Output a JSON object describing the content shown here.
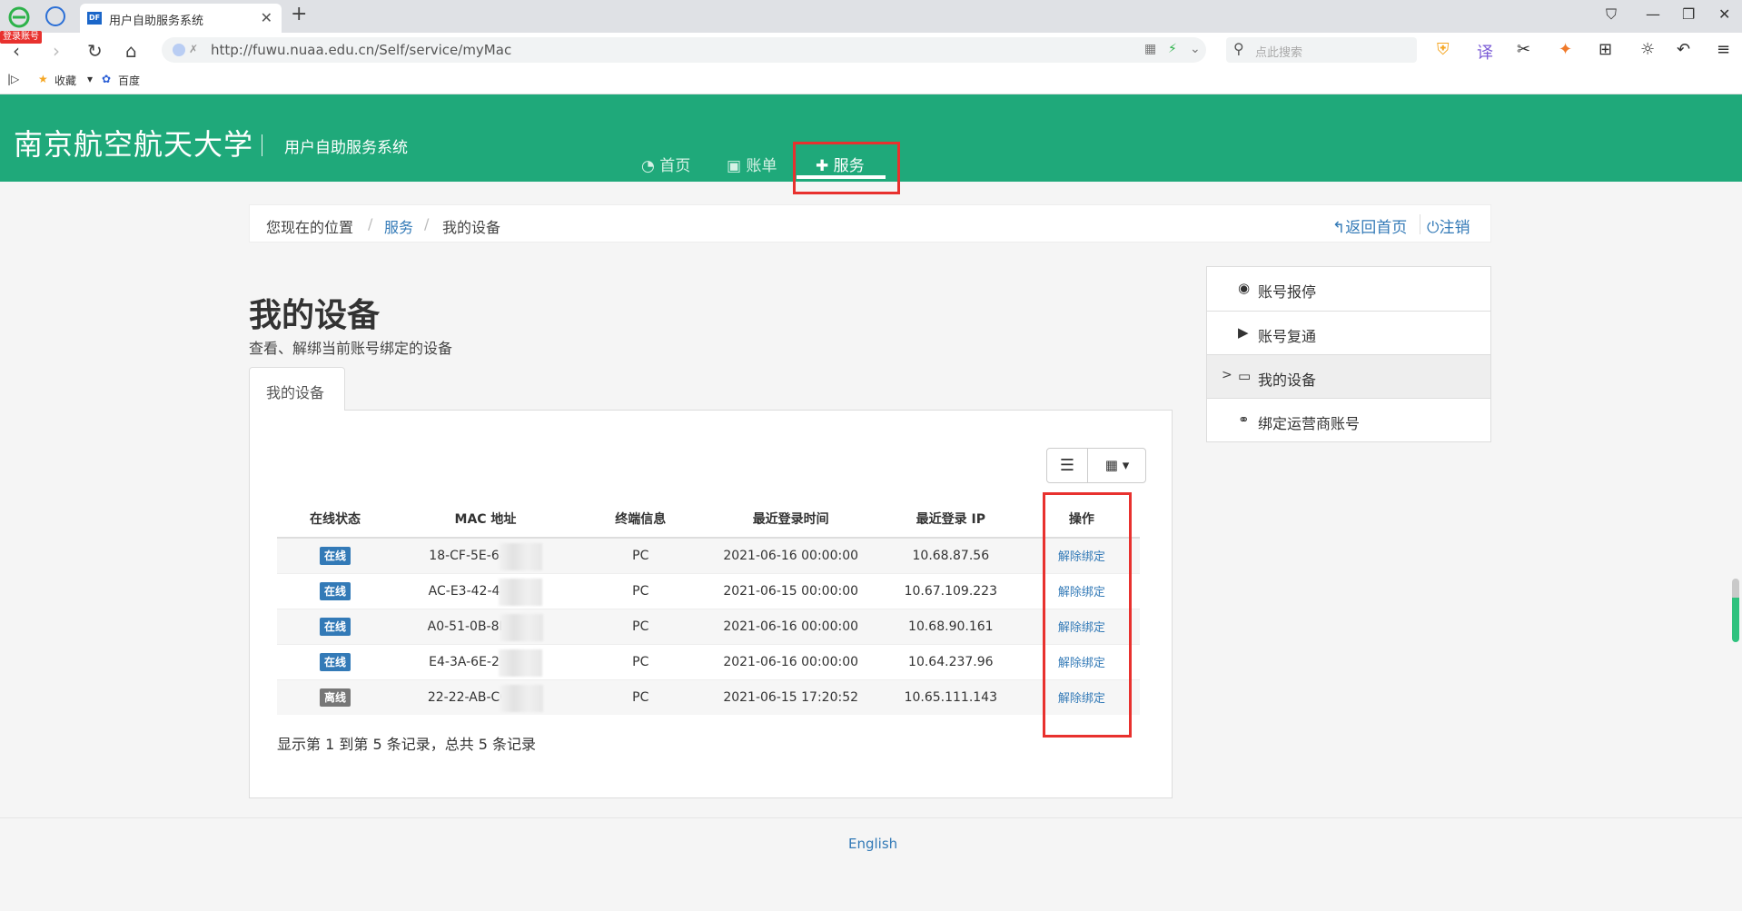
{
  "browser": {
    "login_badge": "登录账号",
    "tab_title": "用户自助服务系统",
    "tab_favicon": "DF",
    "url": "http://fuwu.nuaa.edu.cn/Self/service/myMac",
    "search_placeholder": "点此搜索",
    "bookmarks": [
      "收藏",
      "百度"
    ]
  },
  "header": {
    "school_name": "南京航空航天大学",
    "system_name": "用户自助服务系统",
    "nav": [
      {
        "label": "首页",
        "icon": "dashboard-icon"
      },
      {
        "label": "账单",
        "icon": "money-icon"
      },
      {
        "label": "服务",
        "icon": "puzzle-icon",
        "active": true
      }
    ]
  },
  "breadcrumb": {
    "location": "您现在的位置",
    "level1": "服务",
    "level2": "我的设备",
    "home": "返回首页",
    "logout": "注销"
  },
  "main": {
    "title": "我的设备",
    "subtitle": "查看、解绑当前账号绑定的设备",
    "tab": "我的设备",
    "columns": [
      "在线状态",
      "MAC 地址",
      "终端信息",
      "最近登录时间",
      "最近登录 IP",
      "操作"
    ],
    "rows": [
      {
        "status": "在线",
        "online": true,
        "mac": "18-CF-5E-64",
        "terminal": "PC",
        "time": "2021-06-16 00:00:00",
        "ip": "10.68.87.56",
        "action": "解除绑定"
      },
      {
        "status": "在线",
        "online": true,
        "mac": "AC-E3-42-4E",
        "terminal": "PC",
        "time": "2021-06-15 00:00:00",
        "ip": "10.67.109.223",
        "action": "解除绑定"
      },
      {
        "status": "在线",
        "online": true,
        "mac": "A0-51-0B-8D",
        "terminal": "PC",
        "time": "2021-06-16 00:00:00",
        "ip": "10.68.90.161",
        "action": "解除绑定"
      },
      {
        "status": "在线",
        "online": true,
        "mac": "E4-3A-6E-27",
        "terminal": "PC",
        "time": "2021-06-16 00:00:00",
        "ip": "10.64.237.96",
        "action": "解除绑定"
      },
      {
        "status": "离线",
        "online": false,
        "mac": "22-22-AB-CC",
        "terminal": "PC",
        "time": "2021-06-15 17:20:52",
        "ip": "10.65.111.143",
        "action": "解除绑定"
      }
    ],
    "summary": "显示第 1 到第 5 条记录，总共 5 条记录"
  },
  "sidebar": {
    "items": [
      {
        "label": "账号报停",
        "icon": "stop-circle-icon"
      },
      {
        "label": "账号复通",
        "icon": "play-circle-icon"
      },
      {
        "label": "我的设备",
        "icon": "laptop-icon",
        "active": true,
        "caret": ">"
      },
      {
        "label": "绑定运营商账号",
        "icon": "link-icon"
      }
    ]
  },
  "footer": {
    "language": "English"
  },
  "colors": {
    "brand": "#1fa97a",
    "link": "#337ab7",
    "online": "#337ab7",
    "offline": "#777777",
    "highlight": "#e8312e"
  }
}
